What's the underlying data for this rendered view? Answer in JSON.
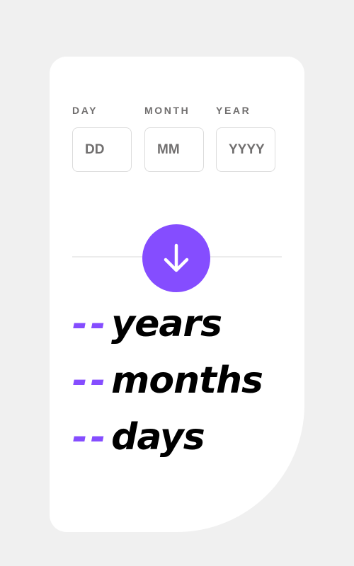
{
  "form": {
    "day_label": "DAY",
    "month_label": "MONTH",
    "year_label": "YEAR",
    "day_placeholder": "DD",
    "month_placeholder": "MM",
    "year_placeholder": "YYYY",
    "day_value": "",
    "month_value": "",
    "year_value": ""
  },
  "submit": {
    "icon": "arrow-down-icon"
  },
  "results": {
    "years_value": "--",
    "years_unit": "years",
    "months_value": "--",
    "months_unit": "months",
    "days_value": "--",
    "days_unit": "days"
  },
  "colors": {
    "accent": "#854dff",
    "page_background": "#f0f0f0",
    "card_background": "#ffffff",
    "label_text": "#716f6f",
    "result_text": "#000000"
  }
}
